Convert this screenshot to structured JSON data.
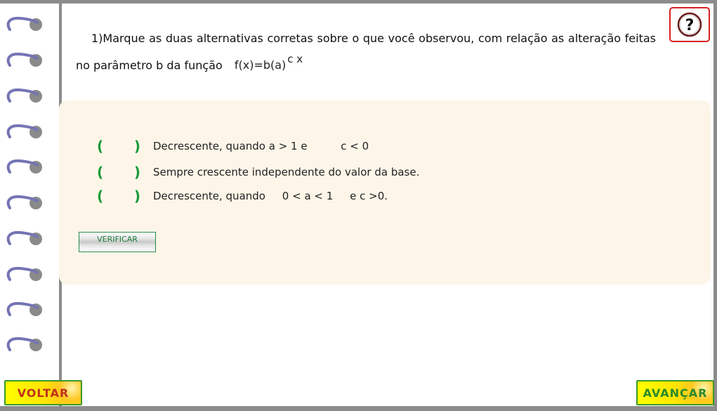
{
  "question": {
    "number": "1)",
    "text": "Marque as duas alternativas corretas sobre o que você observou, com relação as alteração feitas no parâmetro b da função",
    "formula_base": "f(x)=b(a)",
    "formula_exponent": "c x"
  },
  "help": {
    "icon": "question-mark-icon",
    "color": "#d82020"
  },
  "options": [
    {
      "open": "(",
      "close": ")",
      "text": "Decrescente, quando a > 1 e          c < 0",
      "checked": false
    },
    {
      "open": "(",
      "close": ")",
      "text": "Sempre crescente independente do valor da base.",
      "checked": false
    },
    {
      "open": "(",
      "close": ")",
      "text": "Decrescente, quando     0 < a < 1     e c >0.",
      "checked": false
    }
  ],
  "verify_button": {
    "label": "VERIFICAR"
  },
  "nav": {
    "back_label": "VOLTAR",
    "next_label": "AVANÇAR"
  },
  "colors": {
    "accent_green": "#1a9a3a",
    "panel_bg": "#fdf6e8",
    "nav_yellow": "#ffff00",
    "back_text": "#c0321a",
    "next_text": "#2a8a2a"
  }
}
